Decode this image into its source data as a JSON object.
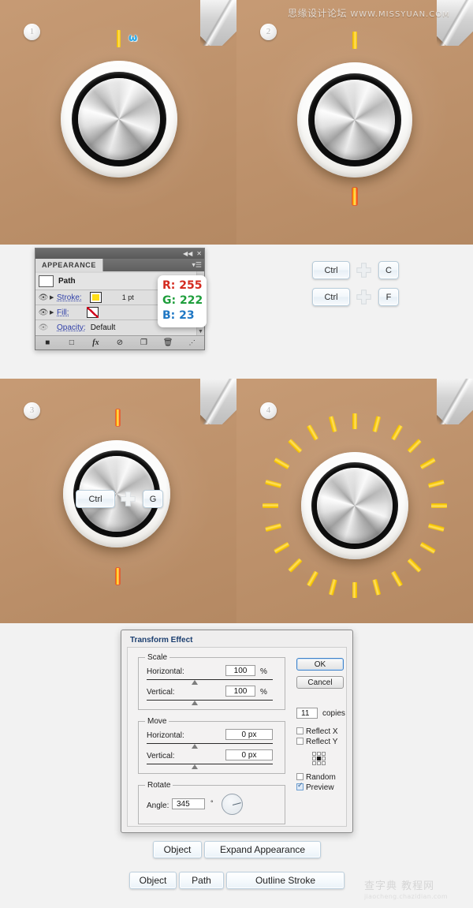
{
  "watermarks": {
    "top": "思缘设计论坛",
    "top_url": "WWW.MISSYUAN.COM",
    "bottom": "查字典 教程网",
    "bottom_url": "jiaocheng.chazidian.com"
  },
  "panels": [
    {
      "step": "1",
      "name": "knob-step-1"
    },
    {
      "step": "2",
      "name": "knob-step-2"
    },
    {
      "step": "3",
      "name": "knob-step-3"
    },
    {
      "step": "4",
      "name": "knob-step-4"
    }
  ],
  "panel1": {
    "web_glyph": "ω"
  },
  "appearance_panel": {
    "collapse_icon": "◀◀",
    "close_icon": "✕",
    "tab_label": "APPEARANCE",
    "menu_icon": "▾☰",
    "rows": [
      {
        "label": "Path",
        "kind": "head"
      },
      {
        "label": "Stroke:",
        "value": "1 pt",
        "swatch": "yellow"
      },
      {
        "label": "Fill:",
        "value": "",
        "swatch": "none"
      },
      {
        "label": "Opacity:",
        "value": "Default",
        "swatch": ""
      }
    ],
    "footer_icons": [
      "■",
      "□",
      "fx",
      "⊘",
      "❐",
      "🗑",
      "⋰"
    ]
  },
  "rgb_callout": {
    "r_label": "R: 255",
    "g_label": "G: 222",
    "b_label": "B: 23",
    "r_color": "#d42a1f",
    "g_color": "#1f9e3c",
    "b_color": "#1f77c4",
    "swatch_hex": "#ffde17"
  },
  "shortcuts": [
    {
      "key1": "Ctrl",
      "key2": "C",
      "name": "shortcut-ctrl-c"
    },
    {
      "key1": "Ctrl",
      "key2": "F",
      "name": "shortcut-ctrl-f"
    }
  ],
  "panel3_shortcut": {
    "key1": "Ctrl",
    "key2": "G"
  },
  "transform_dialog": {
    "title": "Transform Effect",
    "scale": {
      "legend": "Scale",
      "horizontal_label": "Horizontal:",
      "horizontal_value": "100",
      "horizontal_unit": "%",
      "vertical_label": "Vertical:",
      "vertical_value": "100",
      "vertical_unit": "%"
    },
    "move": {
      "legend": "Move",
      "horizontal_label": "Horizontal:",
      "horizontal_value": "0 px",
      "vertical_label": "Vertical:",
      "vertical_value": "0 px"
    },
    "rotate": {
      "legend": "Rotate",
      "angle_label": "Angle:",
      "angle_value": "345",
      "angle_unit": "°"
    },
    "ok_label": "OK",
    "cancel_label": "Cancel",
    "copies_value": "11",
    "copies_label": "copies",
    "reflect_x_label": "Reflect X",
    "reflect_x_checked": false,
    "reflect_y_label": "Reflect Y",
    "reflect_y_checked": false,
    "random_label": "Random",
    "random_checked": false,
    "preview_label": "Preview",
    "preview_checked": true
  },
  "menu_row_1": [
    "Object",
    "Expand Appearance"
  ],
  "menu_row_2": [
    "Object",
    "Path",
    "Outline Stroke"
  ]
}
